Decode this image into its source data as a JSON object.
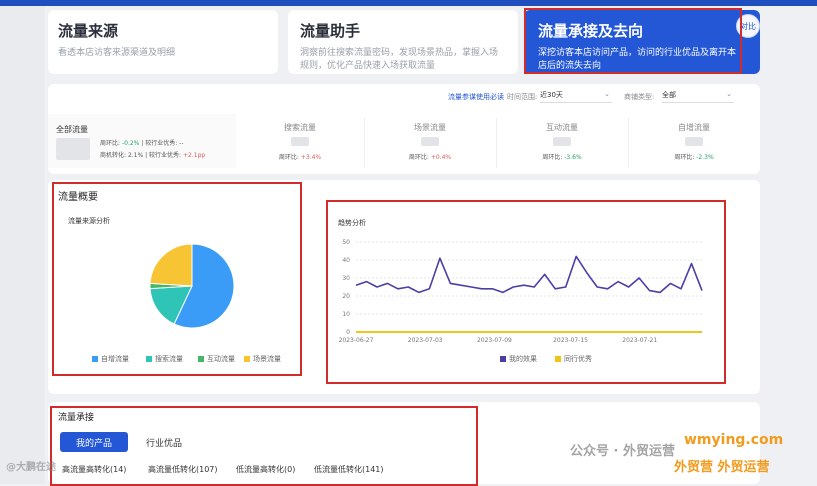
{
  "cards": [
    {
      "title": "流量来源",
      "desc": "看透本店访客来源渠道及明细"
    },
    {
      "title": "流量助手",
      "desc": "洞察前往搜索流量密码，发现场景热品，掌握入场规则，优化产品快速入场获取流量"
    },
    {
      "title": "流量承接及去向",
      "desc": "深挖访客本店访问产品，访问的行业优品及离开本店后的流失去向",
      "badge": "对比"
    }
  ],
  "filters": {
    "link": "流量参谋使用必读",
    "period_label": "时间范围:",
    "period_value": "近30天",
    "channel_label": "商铺类型:",
    "channel_value": "全部"
  },
  "summary": {
    "title": "全部流量",
    "wow_label": "周环比:",
    "wow_value": "-0.2%",
    "peer_label": "较行业优秀:",
    "peer_value": "--",
    "conv_label": "商机转化:",
    "conv_value": "2.1%",
    "conv_peer_label": "较行业优秀:",
    "conv_peer_value": "+2.1pp"
  },
  "kpis": [
    {
      "title": "搜索流量",
      "wow": "周环比:",
      "value": "+3.4%",
      "dir": "up"
    },
    {
      "title": "场景流量",
      "wow": "周环比:",
      "value": "+0.4%",
      "dir": "up"
    },
    {
      "title": "互动流量",
      "wow": "周环比:",
      "value": "-3.6%",
      "dir": "down"
    },
    {
      "title": "自增流量",
      "wow": "周环比:",
      "value": "-2.3%",
      "dir": "down"
    }
  ],
  "overview": {
    "title": "流量概要",
    "pie_title": "流量来源分析",
    "legend": [
      "自增流量",
      "搜索流量",
      "互动流量",
      "场景流量"
    ]
  },
  "trend": {
    "title": "趋势分析",
    "legend": [
      "我的效果",
      "同行优秀"
    ]
  },
  "colors": {
    "self": "#3b9cf7",
    "search": "#2ec4b6",
    "interact": "#45b765",
    "scene": "#f7c534",
    "line_mine": "#4a3fa8",
    "line_peer": "#f0c419"
  },
  "chart_data": [
    {
      "type": "pie",
      "title": "流量来源分析",
      "categories": [
        "自增流量",
        "搜索流量",
        "互动流量",
        "场景流量"
      ],
      "values": [
        57,
        17,
        2,
        24
      ]
    },
    {
      "type": "line",
      "title": "趋势分析",
      "x": [
        "2023-06-27",
        "2023-06-28",
        "2023-06-29",
        "2023-06-30",
        "2023-07-01",
        "2023-07-02",
        "2023-07-03",
        "2023-07-04",
        "2023-07-05",
        "2023-07-06",
        "2023-07-07",
        "2023-07-08",
        "2023-07-09",
        "2023-07-10",
        "2023-07-11",
        "2023-07-12",
        "2023-07-13",
        "2023-07-14",
        "2023-07-15",
        "2023-07-16",
        "2023-07-17",
        "2023-07-18",
        "2023-07-19",
        "2023-07-20",
        "2023-07-21",
        "2023-07-22",
        "2023-07-23",
        "2023-07-24",
        "2023-07-25"
      ],
      "x_ticks": [
        "2023-06-27",
        "2023-07-03",
        "2023-07-09",
        "2023-07-15",
        "2023-07-21"
      ],
      "series": [
        {
          "name": "我的效果",
          "values": [
            26,
            28,
            25,
            27,
            24,
            25,
            22,
            24,
            41,
            27,
            26,
            25,
            24,
            24,
            22,
            25,
            26,
            25,
            32,
            24,
            25,
            42,
            33,
            25,
            24,
            28,
            25,
            30,
            23,
            22,
            27,
            24,
            38,
            23
          ]
        },
        {
          "name": "同行优秀",
          "values": [
            0,
            0,
            0,
            0,
            0,
            0,
            0,
            0,
            0,
            0,
            0,
            0,
            0,
            0,
            0,
            0,
            0,
            0,
            0,
            0,
            0,
            0,
            0,
            0,
            0,
            0,
            0,
            0,
            0,
            0,
            0,
            0,
            0,
            0
          ]
        }
      ],
      "ylim": [
        0,
        50
      ],
      "yticks": [
        0,
        10,
        20,
        30,
        40,
        50
      ]
    }
  ],
  "accept": {
    "title": "流量承接",
    "tabs": [
      "我的产品",
      "行业优品"
    ],
    "subtabs": [
      "高流量高转化(14)",
      "高流量低转化(107)",
      "低流量高转化(0)",
      "低流量低转化(141)"
    ]
  },
  "watermark": {
    "left": "@大鹏在途",
    "center": "公众号 · 外贸运营",
    "brand": "wmying.com",
    "tagline": "外贸营 外贸运营"
  }
}
